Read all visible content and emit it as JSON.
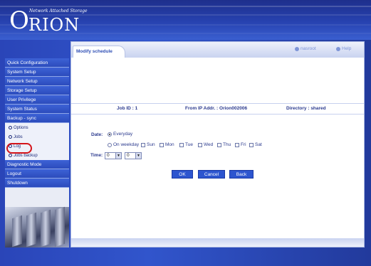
{
  "header": {
    "logo_first": "O",
    "logo_rest": "RION",
    "subtitle": "Network Attached Storage"
  },
  "sidebar": {
    "items": [
      {
        "label": "Quick Configuration"
      },
      {
        "label": "System Setup"
      },
      {
        "label": "Network Setup"
      },
      {
        "label": "Storage Setup"
      },
      {
        "label": "User Privilege"
      },
      {
        "label": "System Status"
      },
      {
        "label": "Backup - sync"
      }
    ],
    "sub_items": [
      {
        "label": "Options"
      },
      {
        "label": "Jobs"
      },
      {
        "label": "Log"
      },
      {
        "label": "Jobs backup"
      }
    ],
    "bottom_items": [
      {
        "label": "Diagnostic Mode"
      },
      {
        "label": "Logout"
      },
      {
        "label": "Shutdown"
      }
    ]
  },
  "main": {
    "tab_label": "Modify schedule",
    "top_links": [
      "nasroot",
      "Help"
    ],
    "info": {
      "job_id": "Job ID : 1",
      "from_ip": "From IP Addr. : Orion002006",
      "directory": "Directory : shared"
    },
    "date_label": "Date:",
    "everyday_label": "Everyday",
    "on_weekday_label": "On weekday",
    "days": [
      "Sun",
      "Mon",
      "Tue",
      "Wed",
      "Thu",
      "Fri",
      "Sat"
    ],
    "time_label": "Time:",
    "hour_value": "0",
    "minute_value": "0",
    "buttons": {
      "ok": "OK",
      "cancel": "Cancel",
      "back": "Back"
    }
  },
  "colors": {
    "accent": "#2d55cf",
    "sidebar_item": "#3d62d6",
    "highlight_circle": "#d4141a"
  }
}
